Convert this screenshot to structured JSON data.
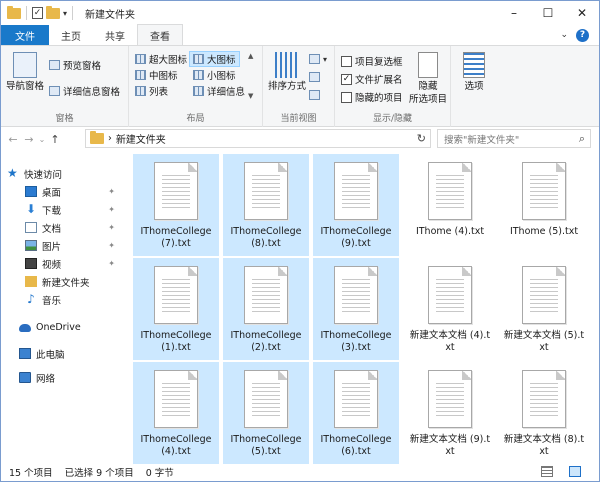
{
  "window": {
    "title": "新建文件夹",
    "controls": {
      "minimize": "–",
      "maximize": "☐",
      "close": "✕"
    },
    "quick_access_dropdown": "▾"
  },
  "ribbon": {
    "tabs": [
      {
        "label": "文件"
      },
      {
        "label": "主页"
      },
      {
        "label": "共享"
      },
      {
        "label": "查看"
      }
    ],
    "collapse_chevron": "⌄",
    "help": "?",
    "panes": {
      "label": "窗格",
      "navigation_pane": "导航窗格",
      "preview_pane": "预览窗格",
      "details_pane": "详细信息窗格"
    },
    "layout": {
      "label": "布局",
      "options": [
        {
          "label": "超大图标"
        },
        {
          "label": "大图标",
          "selected": true
        },
        {
          "label": "中图标"
        },
        {
          "label": "小图标"
        },
        {
          "label": "列表"
        },
        {
          "label": "详细信息"
        }
      ]
    },
    "current_view": {
      "label": "当前视图",
      "sort_by": "排序方式"
    },
    "show_hide": {
      "label": "显示/隐藏",
      "item_checkboxes": {
        "label": "项目复选框",
        "checked": false
      },
      "file_extensions": {
        "label": "文件扩展名",
        "checked": true
      },
      "hidden_items": {
        "label": "隐藏的项目",
        "checked": false
      },
      "hide_selected": "隐藏\n所选项目"
    },
    "options": "选项"
  },
  "address": {
    "back": "←",
    "forward": "→",
    "recent": "⌄",
    "up": "↑",
    "separator": "›",
    "path": "新建文件夹",
    "refresh": "↻",
    "search_placeholder": "搜索\"新建文件夹\"",
    "search_icon": "⌕"
  },
  "nav": {
    "quick_access": "快速访问",
    "pin_glyph": "✦",
    "items": [
      {
        "label": "桌面",
        "pinned": true
      },
      {
        "label": "下载",
        "pinned": true
      },
      {
        "label": "文档",
        "pinned": true
      },
      {
        "label": "图片",
        "pinned": true
      },
      {
        "label": "视频",
        "pinned": true
      },
      {
        "label": "新建文件夹",
        "pinned": false
      },
      {
        "label": "音乐",
        "pinned": false
      }
    ],
    "onedrive": "OneDrive",
    "this_pc": "此电脑",
    "network": "网络"
  },
  "files": [
    {
      "name": "IThomeCollege (7).txt",
      "selected": true
    },
    {
      "name": "IThomeCollege (8).txt",
      "selected": true
    },
    {
      "name": "IThomeCollege (9).txt",
      "selected": true
    },
    {
      "name": "IThome (4).txt",
      "selected": false
    },
    {
      "name": "IThome (5).txt",
      "selected": false
    },
    {
      "name": "IThomeCollege (1).txt",
      "selected": true
    },
    {
      "name": "IThomeCollege (2).txt",
      "selected": true
    },
    {
      "name": "IThomeCollege (3).txt",
      "selected": true
    },
    {
      "name": "新建文本文档 (4).txt",
      "selected": false
    },
    {
      "name": "新建文本文档 (5).txt",
      "selected": false
    },
    {
      "name": "IThomeCollege (4).txt",
      "selected": true
    },
    {
      "name": "IThomeCollege (5).txt",
      "selected": true
    },
    {
      "name": "IThomeCollege (6).txt",
      "selected": true
    },
    {
      "name": "新建文本文档 (9).txt",
      "selected": false
    },
    {
      "name": "新建文本文档 (8).txt",
      "selected": false
    }
  ],
  "status": {
    "item_count": "15 个项目",
    "selected": "已选择 9 个项目",
    "size": "0 字节"
  }
}
